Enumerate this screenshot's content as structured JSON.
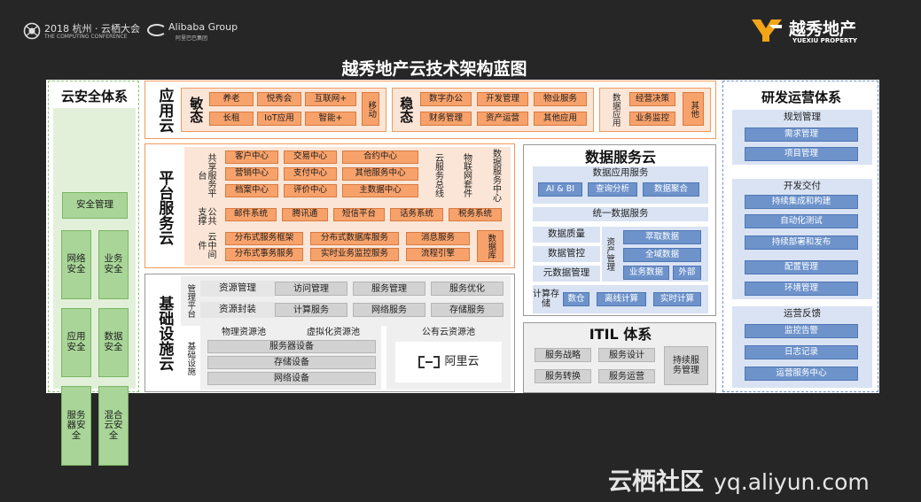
{
  "header": {
    "event": "2018 杭州 · 云栖大会",
    "event_sub": "THE COMPUTING CONFERENCE",
    "alibaba": "Alibaba Group",
    "alibaba_cn": "阿里巴巴集团",
    "brand_cn": "越秀地产",
    "brand_en": "YUEXIU PROPERTY",
    "title": "越秀地产云技术架构蓝图"
  },
  "security": {
    "title": "云安全体系",
    "mgmt": "安全管理",
    "items": [
      "网络安全",
      "业务安全",
      "应用安全",
      "数据安全",
      "服务器安全",
      "混合云安全"
    ]
  },
  "app_cloud": {
    "title": "应用云",
    "agile": "敏态",
    "agile_items": [
      "养老",
      "悦秀会",
      "互联网+",
      "长租",
      "IoT应用",
      "智能+"
    ],
    "mobile": "移动",
    "stable": "稳态",
    "stable_items": [
      "数字办公",
      "开发管理",
      "物业服务",
      "财务管理",
      "资产运营",
      "其他应用"
    ],
    "data_app": "数据应用",
    "data_items": [
      "经营决策",
      "业务监控"
    ],
    "other": "其他"
  },
  "platform": {
    "title": "平台服务云",
    "shared_label": "共享服务平台",
    "shared": [
      "客户中心",
      "交易中心",
      "合约中心",
      "营销中心",
      "支付中心",
      "其他服务中心",
      "档案中心",
      "评价中心",
      "主数据中心"
    ],
    "bus_label": "云服务总线",
    "iot_label": "物联网套件",
    "data_center": "数据服务中心",
    "public_label": "公共支撑",
    "public": [
      "邮件系统",
      "腾讯通",
      "短信平台",
      "话务系统",
      "税务系统"
    ],
    "mw_label": "云中间件",
    "mw": [
      "分布式服务框架",
      "分布式数据库服务",
      "消息服务",
      "分布式事务服务",
      "实时业务监控服务",
      "流程引擎"
    ],
    "db_label": "数据库"
  },
  "infra": {
    "title": "基础设施云",
    "mgmt_label": "管理平台",
    "row1_label": "资源管理",
    "row1": [
      "访问管理",
      "服务管理",
      "服务优化"
    ],
    "row2_label": "资源封装",
    "row2": [
      "计算服务",
      "网络服务",
      "存储服务"
    ],
    "base_label": "基础设施",
    "phys_pool": "物理资源池",
    "virt_pool": "虚拟化资源池",
    "devices": [
      "服务器设备",
      "存储设备",
      "网络设备"
    ],
    "public_pool": "公有云资源池",
    "aliyun": "阿里云"
  },
  "data_cloud": {
    "title": "数据服务云",
    "app_label": "数据应用服务",
    "apps": [
      "AI & BI",
      "查询分析",
      "数据聚合"
    ],
    "unified": "统一数据服务",
    "quality": "数据质量",
    "governance": "数据管控",
    "metadata": "元数据管理",
    "asset_label": "资产管理",
    "assets": [
      "萃取数据",
      "全域数据",
      "业务数据",
      "外部"
    ],
    "compute_label": "计算存储",
    "compute": [
      "数仓",
      "离线计算",
      "实时计算"
    ]
  },
  "itil": {
    "title": "ITIL 体系",
    "items": [
      "服务战略",
      "服务设计",
      "服务转换",
      "服务运营"
    ],
    "continuous": "持续服务管理"
  },
  "devops": {
    "title": "研发运营体系",
    "planning": "规划管理",
    "planning_items": [
      "需求管理",
      "项目管理"
    ],
    "delivery": "开发交付",
    "delivery_items": [
      "持续集成和构建",
      "自动化测试",
      "持续部署和发布",
      "配置管理",
      "环境管理"
    ],
    "ops": "运营反馈",
    "ops_items": [
      "监控告警",
      "日志记录",
      "运营服务中心"
    ]
  },
  "watermark": {
    "cn": "云栖社区",
    "url": "yq.aliyun.com"
  }
}
